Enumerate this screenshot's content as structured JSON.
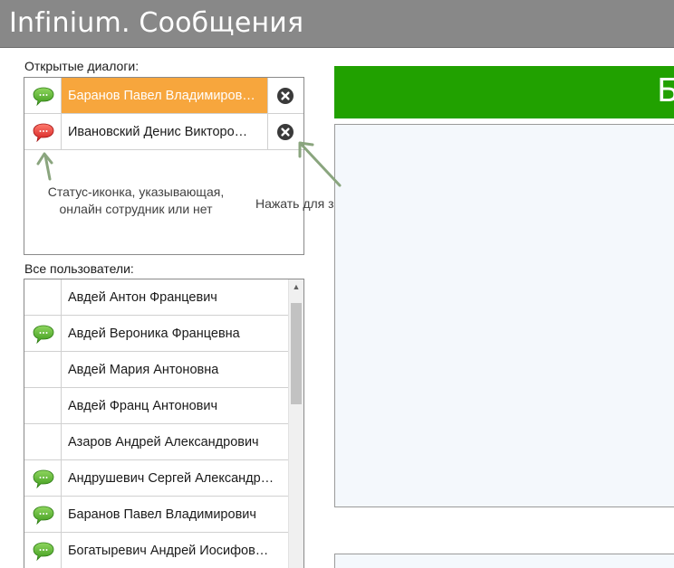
{
  "app": {
    "title": "Infinium. Сообщения"
  },
  "open_dialogs": {
    "label": "Открытые диалоги:",
    "items": [
      {
        "name": "Баранов Павел Владимиров…",
        "status": "online",
        "active": true
      },
      {
        "name": "Ивановский Денис Викторо…",
        "status": "offline",
        "active": false
      }
    ]
  },
  "annotations": {
    "status_icon": "Статус-иконка, указывающая, онлайн сотрудник или нет",
    "close_hint": "Нажать для закрытия диалога"
  },
  "all_users": {
    "label": "Все пользователи:",
    "items": [
      {
        "name": "Авдей Антон Францевич",
        "status": "none"
      },
      {
        "name": "Авдей Вероника Францевна",
        "status": "online"
      },
      {
        "name": "Авдей Мария Антоновна",
        "status": "none"
      },
      {
        "name": "Авдей Франц Антонович",
        "status": "none"
      },
      {
        "name": "Азаров Андрей Александрович",
        "status": "none"
      },
      {
        "name": "Андрушевич Сергей Александр…",
        "status": "online"
      },
      {
        "name": "Баранов Павел Владимирович",
        "status": "online"
      },
      {
        "name": "Богатыревич Андрей Иосифов…",
        "status": "online"
      }
    ]
  },
  "chat": {
    "header_text": "Б"
  },
  "colors": {
    "titlebar": "#888888",
    "active_dialog": "#f7a63d",
    "header_green": "#21a100",
    "online_icon": "#5cb52e",
    "offline_icon": "#e03a3a",
    "annotation_arrow": "#8aa57e"
  },
  "icons": {
    "status_online": "green-chat-bubble-icon",
    "status_offline": "red-chat-bubble-icon",
    "close": "close-circle-icon",
    "scroll_up": "triangle-up-icon"
  }
}
